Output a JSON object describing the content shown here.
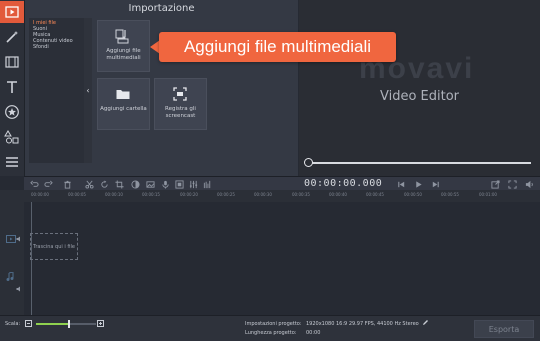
{
  "import_panel": {
    "title": "Importazione",
    "categories": [
      "I miei file",
      "Suoni",
      "Musica",
      "Contenuti video",
      "Sfondi"
    ],
    "tiles": {
      "add_media": "Aggiungi file multimediali",
      "add_folder": "Aggiungi cartella",
      "record": "Registra gli screencast"
    }
  },
  "callout": {
    "text": "Aggiungi file multimediali"
  },
  "player": {
    "logo": "movavi",
    "subtitle": "Video Editor",
    "progress": 0.0
  },
  "toolbar": {
    "timecode": "00:00:00.000"
  },
  "ruler": {
    "ticks": [
      "00:00:00",
      "00:00:05",
      "00:00:10",
      "00:00:15",
      "00:00:20",
      "00:00:25",
      "00:00:30",
      "00:00:35",
      "00:00:40",
      "00:00:45",
      "00:00:50",
      "00:00:55",
      "00:01:00"
    ]
  },
  "timeline": {
    "drop_hint": "Trascina qui i file"
  },
  "status": {
    "scale_label": "Scala:",
    "scale_level": 0.55,
    "settings_label": "Impostazioni progetto:",
    "settings_value": "1920x1080 16:9 29.97 FPS, 44100 Hz Stereo",
    "length_label": "Lunghezza progetto:",
    "length_value": "00:00",
    "export_label": "Esporta"
  },
  "colors": {
    "accent": "#f0663f",
    "active_tool": "#e25a3b",
    "scale_fill": "#8fd14f"
  }
}
